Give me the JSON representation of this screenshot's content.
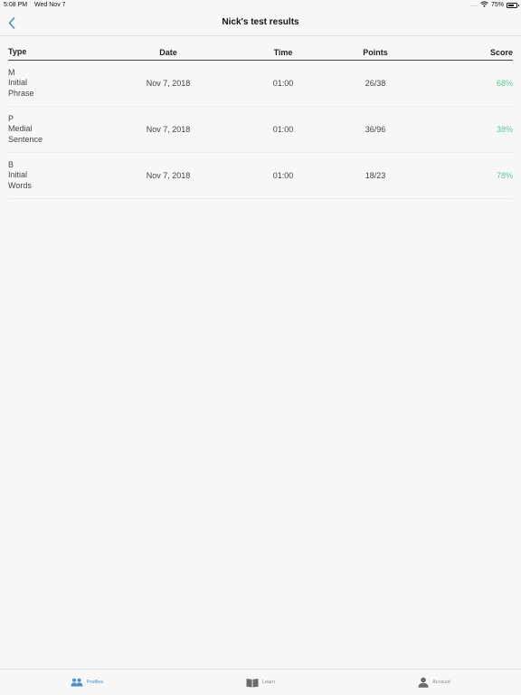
{
  "status_bar": {
    "time": "5:08 PM",
    "date": "Wed Nov 7",
    "signal": ".....",
    "battery_text": "75%",
    "battery_level": 0.75
  },
  "nav": {
    "title": "Nick's test results",
    "back_icon": "chevron-left-icon"
  },
  "table": {
    "headers": {
      "type": "Type",
      "date": "Date",
      "time": "Time",
      "points": "Points",
      "score": "Score"
    },
    "rows": [
      {
        "type_lines": [
          "M",
          "Initial",
          "Phrase"
        ],
        "date": "Nov 7, 2018",
        "time": "01:00",
        "points": "26/38",
        "score": "68%"
      },
      {
        "type_lines": [
          "P",
          "Medial",
          "Sentence"
        ],
        "date": "Nov 7, 2018",
        "time": "01:00",
        "points": "36/96",
        "score": "38%"
      },
      {
        "type_lines": [
          "B",
          "Initial",
          "Words"
        ],
        "date": "Nov 7, 2018",
        "time": "01:00",
        "points": "18/23",
        "score": "78%"
      }
    ]
  },
  "tabs": [
    {
      "label": "Profiles",
      "icon": "profiles-icon",
      "active": true
    },
    {
      "label": "Learn",
      "icon": "book-icon",
      "active": false
    },
    {
      "label": "Account",
      "icon": "person-icon",
      "active": false
    }
  ],
  "colors": {
    "accent": "#4a8fc8",
    "score": "#5cc898"
  }
}
